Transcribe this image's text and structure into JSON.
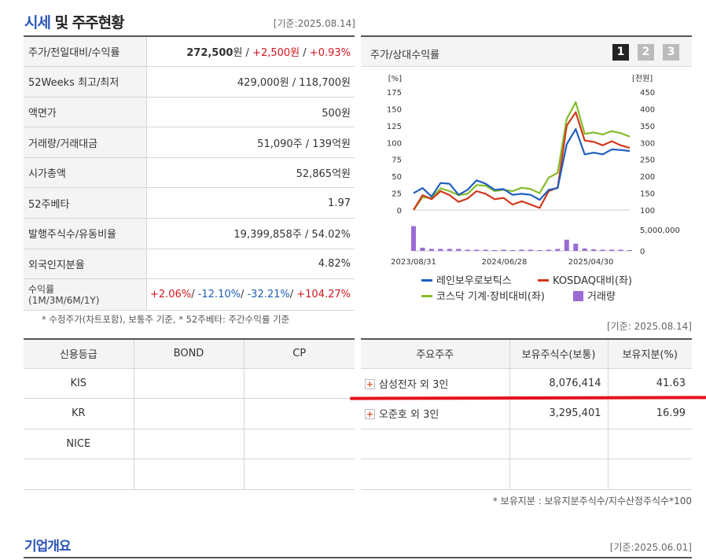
{
  "header": {
    "title_blue": "시세",
    "title_rest": " 및 주주현황",
    "date": "[기준:2025.08.14]"
  },
  "price_table": [
    {
      "label": "주가/전일대비/수익률",
      "value_parts": [
        "272,500",
        "원 / ",
        "+2,500원",
        " / ",
        "+0.93%"
      ]
    },
    {
      "label": "52Weeks 최고/최저",
      "value": "429,000원 / 118,700원"
    },
    {
      "label": "액면가",
      "value": "500원"
    },
    {
      "label": "거래량/거래대금",
      "value": "51,090주 / 139억원"
    },
    {
      "label": "시가총액",
      "value": "52,865억원"
    },
    {
      "label": "52주베타",
      "value": "1.97"
    },
    {
      "label": "발행주식수/유동비율",
      "value": "19,399,858주 / 54.02%"
    },
    {
      "label": "외국인지분율",
      "value": "4.82%"
    },
    {
      "label": "수익률",
      "label_sub": "(1M/3M/6M/1Y)",
      "returns": [
        "+2.06%",
        "-12.10%",
        "-32.21%",
        "+104.27%"
      ]
    }
  ],
  "note1": "* 수정주가(차트포함), 보통주 기준, * 52주베타: 주간수익률 기준",
  "chart_panel": {
    "title": "주가/상대수익률",
    "pages": [
      "1",
      "2",
      "3"
    ],
    "active_page": "1"
  },
  "chart_data": {
    "type": "line",
    "left_unit": "[%]",
    "right_unit": "[천원]",
    "left_ticks": [
      "175",
      "150",
      "125",
      "100",
      "75",
      "50",
      "25",
      "0"
    ],
    "right_ticks": [
      "450",
      "400",
      "350",
      "300",
      "250",
      "200",
      "150",
      "100"
    ],
    "volume_tick": "5,000,000",
    "volume_zero": "0",
    "x_ticks": [
      "2023/08/31",
      "2024/06/28",
      "2025/04/30"
    ],
    "ylim_left": [
      0,
      175
    ],
    "ylim_right": [
      100,
      450
    ],
    "series": [
      {
        "name": "레인보우로보틱스",
        "color": "#1f5fbf",
        "axis": "right",
        "values": [
          150,
          165,
          140,
          180,
          178,
          145,
          160,
          188,
          178,
          160,
          162,
          145,
          148,
          145,
          130,
          160,
          165,
          295,
          340,
          265,
          270,
          265,
          280,
          278,
          275
        ]
      },
      {
        "name": "KOSDAQ대비(좌)",
        "color": "#d0381b",
        "axis": "left",
        "values": [
          0,
          22,
          16,
          28,
          22,
          12,
          17,
          28,
          24,
          16,
          18,
          8,
          13,
          8,
          3,
          28,
          33,
          125,
          145,
          103,
          101,
          96,
          102,
          96,
          92
        ]
      },
      {
        "name": "코스닥 기계·장비대비(좌)",
        "color": "#84bc2a",
        "axis": "left",
        "values": [
          0,
          19,
          18,
          32,
          28,
          22,
          24,
          37,
          36,
          28,
          30,
          28,
          33,
          31,
          25,
          48,
          55,
          135,
          160,
          113,
          115,
          112,
          117,
          114,
          109
        ]
      }
    ],
    "volume": {
      "name": "거래량",
      "color": "#9b6bd4",
      "values": [
        6200000,
        800000,
        500000,
        500000,
        500000,
        500000,
        300000,
        300000,
        300000,
        200000,
        300000,
        200000,
        300000,
        300000,
        200000,
        300000,
        500000,
        2800000,
        1800000,
        600000,
        400000,
        300000,
        300000,
        300000,
        200000
      ]
    }
  },
  "legend": {
    "s1": "레인보우로보틱스",
    "s2": "KOSDAQ대비(좌)",
    "s3": "코스닥 기계·장비대비(좌)",
    "s4": "거래량"
  },
  "date2": "[기준: 2025.08.14]",
  "credit_table": {
    "headers": [
      "신용등급",
      "BOND",
      "CP"
    ],
    "rows": [
      [
        "KIS",
        "",
        ""
      ],
      [
        "KR",
        "",
        ""
      ],
      [
        "NICE",
        "",
        ""
      ],
      [
        "",
        "",
        ""
      ]
    ]
  },
  "holder_table": {
    "headers": [
      "주요주주",
      "보유주식수(보통)",
      "보유지분(%)"
    ],
    "rows": [
      {
        "name": "삼성전자 외 3인",
        "shares": "8,076,414",
        "pct": "41.63"
      },
      {
        "name": "오준호 외 3인",
        "shares": "3,295,401",
        "pct": "16.99"
      },
      {
        "name": "",
        "shares": "",
        "pct": ""
      },
      {
        "name": "",
        "shares": "",
        "pct": ""
      }
    ]
  },
  "note2": "* 보유지분 : 보유지분주식수/지수산정주식수*100",
  "section2": {
    "title": "기업개요",
    "date": "[기준:2025.06.01]"
  }
}
